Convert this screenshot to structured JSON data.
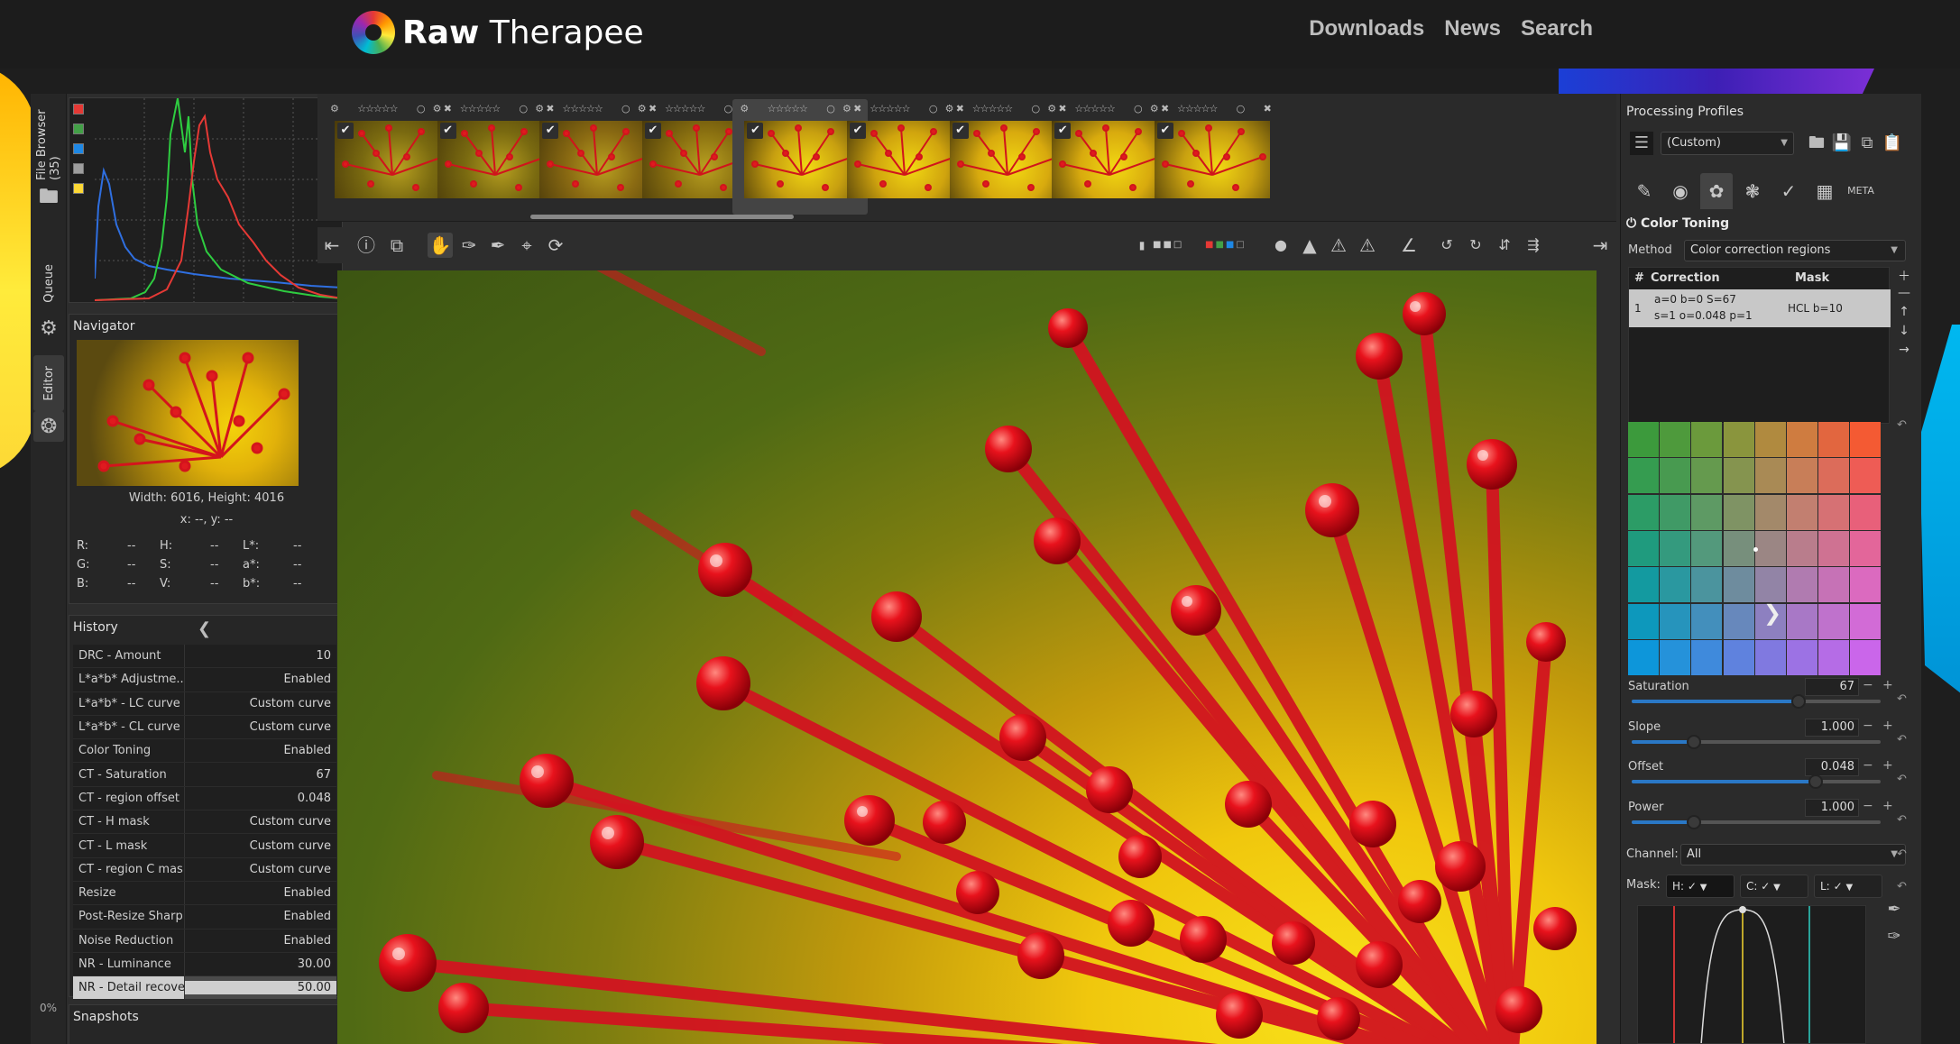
{
  "site": {
    "logo_bold": "Raw",
    "logo_rest": " Therapee",
    "nav": [
      "Downloads",
      "News",
      "Search"
    ]
  },
  "vtabs": {
    "file_browser": "File Browser (35)",
    "queue": "Queue",
    "editor": "Editor",
    "percent": "0%"
  },
  "histogram": {
    "swatches": [
      "#e53935",
      "#43a047",
      "#1e88e5",
      "#9e9e9e",
      "#fdd835"
    ]
  },
  "navigator": {
    "title": "Navigator",
    "dimensions": "Width: 6016, Height: 4016",
    "coords": "x: --, y: --",
    "rows": [
      [
        {
          "k": "R:",
          "v": "--"
        },
        {
          "k": "H:",
          "v": "--"
        },
        {
          "k": "L*:",
          "v": "--"
        }
      ],
      [
        {
          "k": "G:",
          "v": "--"
        },
        {
          "k": "S:",
          "v": "--"
        },
        {
          "k": "a*:",
          "v": "--"
        }
      ],
      [
        {
          "k": "B:",
          "v": "--"
        },
        {
          "k": "V:",
          "v": "--"
        },
        {
          "k": "b*:",
          "v": "--"
        }
      ]
    ]
  },
  "history": {
    "title": "History",
    "items": [
      {
        "name": "DRC - Amount",
        "value": "10"
      },
      {
        "name": "L*a*b* Adjustme...",
        "value": "Enabled"
      },
      {
        "name": "L*a*b* - LC curve",
        "value": "Custom curve"
      },
      {
        "name": "L*a*b* - CL curve",
        "value": "Custom curve"
      },
      {
        "name": "Color Toning",
        "value": "Enabled"
      },
      {
        "name": "CT - Saturation",
        "value": "67"
      },
      {
        "name": "CT - region offset",
        "value": "0.048"
      },
      {
        "name": "CT - H mask",
        "value": "Custom curve"
      },
      {
        "name": "CT - L mask",
        "value": "Custom curve"
      },
      {
        "name": "CT - region C mask",
        "value": "Custom curve"
      },
      {
        "name": "Resize",
        "value": "Enabled"
      },
      {
        "name": "Post-Resize Sharp...",
        "value": "Enabled"
      },
      {
        "name": "Noise Reduction",
        "value": "Enabled"
      },
      {
        "name": "NR - Luminance",
        "value": "30.00"
      },
      {
        "name": "NR - Detail recove...",
        "value": "50.00"
      }
    ],
    "selected_index": 14
  },
  "snapshots": {
    "title": "Snapshots"
  },
  "filmstrip": {
    "rating_glyphs": "☆☆☆☆☆",
    "count": 9,
    "selected_index": 4
  },
  "profiles": {
    "title": "Processing Profiles",
    "current": "(Custom)"
  },
  "color_toning": {
    "title": "Color Toning",
    "method_label": "Method",
    "method_value": "Color correction regions",
    "col_num": "#",
    "col_correction": "Correction",
    "col_mask": "Mask",
    "region": {
      "num": "1",
      "line1": "a=0 b=0 S=67",
      "line2": "s=1 o=0.048 p=1",
      "mask": "HCL b=10"
    },
    "sliders": [
      {
        "label": "Saturation",
        "value": "67",
        "fraction": 0.67
      },
      {
        "label": "Slope",
        "value": "1.000",
        "fraction": 0.25
      },
      {
        "label": "Offset",
        "value": "0.048",
        "fraction": 0.74
      },
      {
        "label": "Power",
        "value": "1.000",
        "fraction": 0.25
      }
    ],
    "channel_label": "Channel:",
    "channel_value": "All",
    "mask_label": "Mask:",
    "mask_h": "H:",
    "mask_c": "C:",
    "mask_l": "L:"
  },
  "grid_colors": [
    [
      "#3c9a3c",
      "#4e9a3c",
      "#6b9a3c",
      "#8a953d",
      "#b08a3f",
      "#cf7c40",
      "#e2663f",
      "#f45a33"
    ],
    [
      "#359c50",
      "#489a50",
      "#659a4e",
      "#85944f",
      "#a98a55",
      "#c87e58",
      "#dc6c5a",
      "#ee5c55"
    ],
    [
      "#2c9c66",
      "#409a66",
      "#5e9a64",
      "#7f9364",
      "#a3896a",
      "#c27f70",
      "#d67174",
      "#e8607a"
    ],
    [
      "#1f9b7e",
      "#349a7e",
      "#53997c",
      "#778f7c",
      "#9b8684",
      "#b97d8c",
      "#cf7292",
      "#e3669a"
    ],
    [
      "#139aa0",
      "#2a98a0",
      "#4b949e",
      "#6e8c9e",
      "#9284a6",
      "#b07bb0",
      "#c672b6",
      "#db6abf"
    ],
    [
      "#0d98bc",
      "#2694bc",
      "#438fbc",
      "#6788bc",
      "#8d80c0",
      "#a878c6",
      "#bf72cc",
      "#d26bd6"
    ],
    [
      "#0d96da",
      "#2592da",
      "#3f8adc",
      "#5f82de",
      "#8079e0",
      "#9c72e4",
      "#b56ce6",
      "#ca66ea"
    ]
  ]
}
